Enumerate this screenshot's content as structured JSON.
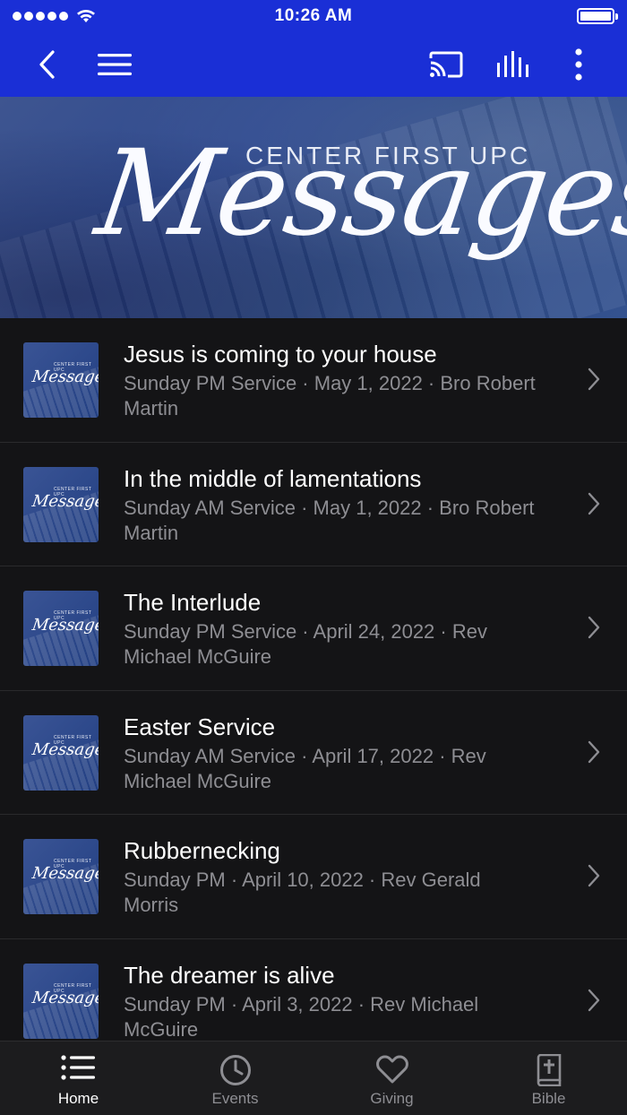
{
  "status_bar": {
    "time": "10:26 AM"
  },
  "nav": {
    "back_icon": "chevron-left-icon",
    "menu_icon": "hamburger-menu-icon",
    "cast_icon": "cast-icon",
    "audio_icon": "audio-bars-icon",
    "more_icon": "more-vertical-icon"
  },
  "banner": {
    "subtitle": "CENTER FIRST UPC",
    "title": "Messages"
  },
  "thumbnail": {
    "subtitle": "CENTER FIRST UPC",
    "title": "Messages"
  },
  "messages": [
    {
      "title": "Jesus is coming to your house",
      "meta": "Sunday PM Service · May 1, 2022 · Bro Robert Martin"
    },
    {
      "title": "In the middle of lamentations",
      "meta": "Sunday AM Service · May 1, 2022 · Bro Robert Martin"
    },
    {
      "title": "The Interlude",
      "meta": "Sunday PM Service · April 24, 2022 · Rev Michael McGuire"
    },
    {
      "title": "Easter Service",
      "meta": "Sunday AM Service · April 17, 2022 · Rev Michael McGuire"
    },
    {
      "title": "Rubbernecking",
      "meta": "Sunday PM · April 10, 2022 · Rev Gerald Morris"
    },
    {
      "title": "The dreamer is alive",
      "meta": "Sunday PM · April 3, 2022 · Rev Michael McGuire"
    }
  ],
  "tabs": [
    {
      "label": "Home",
      "icon": "list-icon",
      "active": true
    },
    {
      "label": "Events",
      "icon": "clock-icon",
      "active": false
    },
    {
      "label": "Giving",
      "icon": "heart-icon",
      "active": false
    },
    {
      "label": "Bible",
      "icon": "bible-icon",
      "active": false
    }
  ],
  "colors": {
    "brand": "#1a2fd6",
    "background": "#141416",
    "secondary_text": "#8e8e93"
  }
}
